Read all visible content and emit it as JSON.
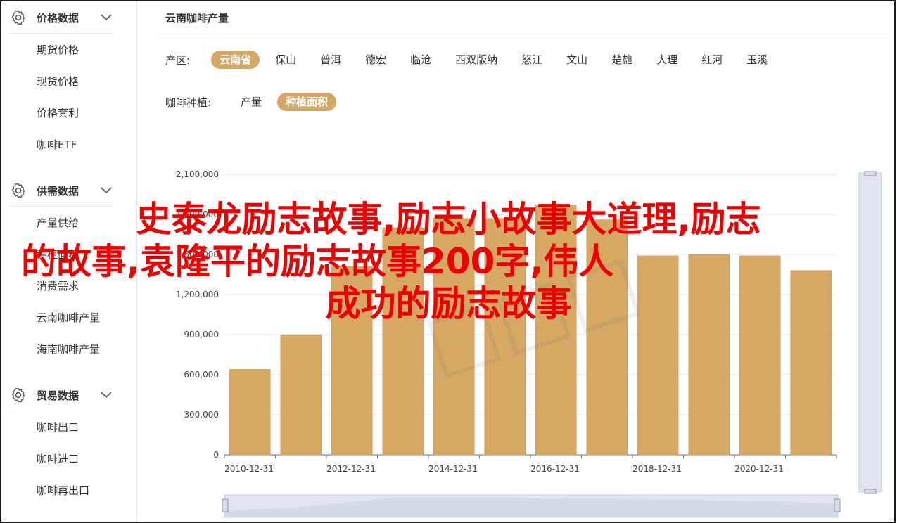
{
  "sidebar": {
    "groups": [
      {
        "title": "价格数据",
        "items": [
          "期货价格",
          "现货价格",
          "价格套利",
          "咖啡ETF"
        ]
      },
      {
        "title": "供需数据",
        "items": [
          "产量供给",
          "种植面积",
          "消费需求",
          "云南咖啡产量",
          "海南咖啡产量"
        ]
      },
      {
        "title": "贸易数据",
        "items": [
          "咖啡出口",
          "咖啡进口",
          "咖啡再出口"
        ]
      }
    ]
  },
  "main": {
    "title": "云南咖啡产量",
    "region_label": "产区:",
    "regions": [
      "云南省",
      "保山",
      "普洱",
      "德宏",
      "临沧",
      "西双版纳",
      "怒江",
      "文山",
      "楚雄",
      "大理",
      "红河",
      "玉溪"
    ],
    "active_region": "云南省",
    "crop_label": "咖啡种植:",
    "crops": [
      "产量",
      "种植面积"
    ],
    "active_crop": "种植面积"
  },
  "overlay": {
    "line1": "史泰龙励志故事,励志小故事大道理,励志",
    "line2": "的故事,袁隆平的励志故事200字,伟人",
    "line3": "成功的励志故事"
  },
  "colors": {
    "accent": "#d4a766",
    "bar": "#d6a864",
    "bar_stroke": "#c99a55",
    "overlay_text": "#ee0000"
  },
  "chart_data": {
    "type": "bar",
    "categories": [
      "2010-12-31",
      "2011-12-31",
      "2012-12-31",
      "2013-12-31",
      "2014-12-31",
      "2015-12-31",
      "2016-12-31",
      "2017-12-31",
      "2018-12-31",
      "2019-12-31",
      "2020-12-31",
      "2021-12-31"
    ],
    "x_tick_labels": [
      "2010-12-31",
      "2012-12-31",
      "2014-12-31",
      "2016-12-31",
      "2018-12-31",
      "2020-12-31"
    ],
    "values": [
      640000,
      900000,
      1410000,
      1700000,
      1770000,
      1770000,
      1870000,
      1760000,
      1490000,
      1500000,
      1490000,
      1380000
    ],
    "ylim": [
      0,
      2100000
    ],
    "y_ticks": [
      0,
      300000,
      600000,
      900000,
      1200000,
      1500000,
      1800000,
      2100000
    ],
    "y_tick_labels": [
      "0",
      "300,000",
      "600,000",
      "900,000",
      "1,200,000",
      "1,500,000",
      "1,800,000",
      "2,100,000"
    ],
    "grid": true
  }
}
